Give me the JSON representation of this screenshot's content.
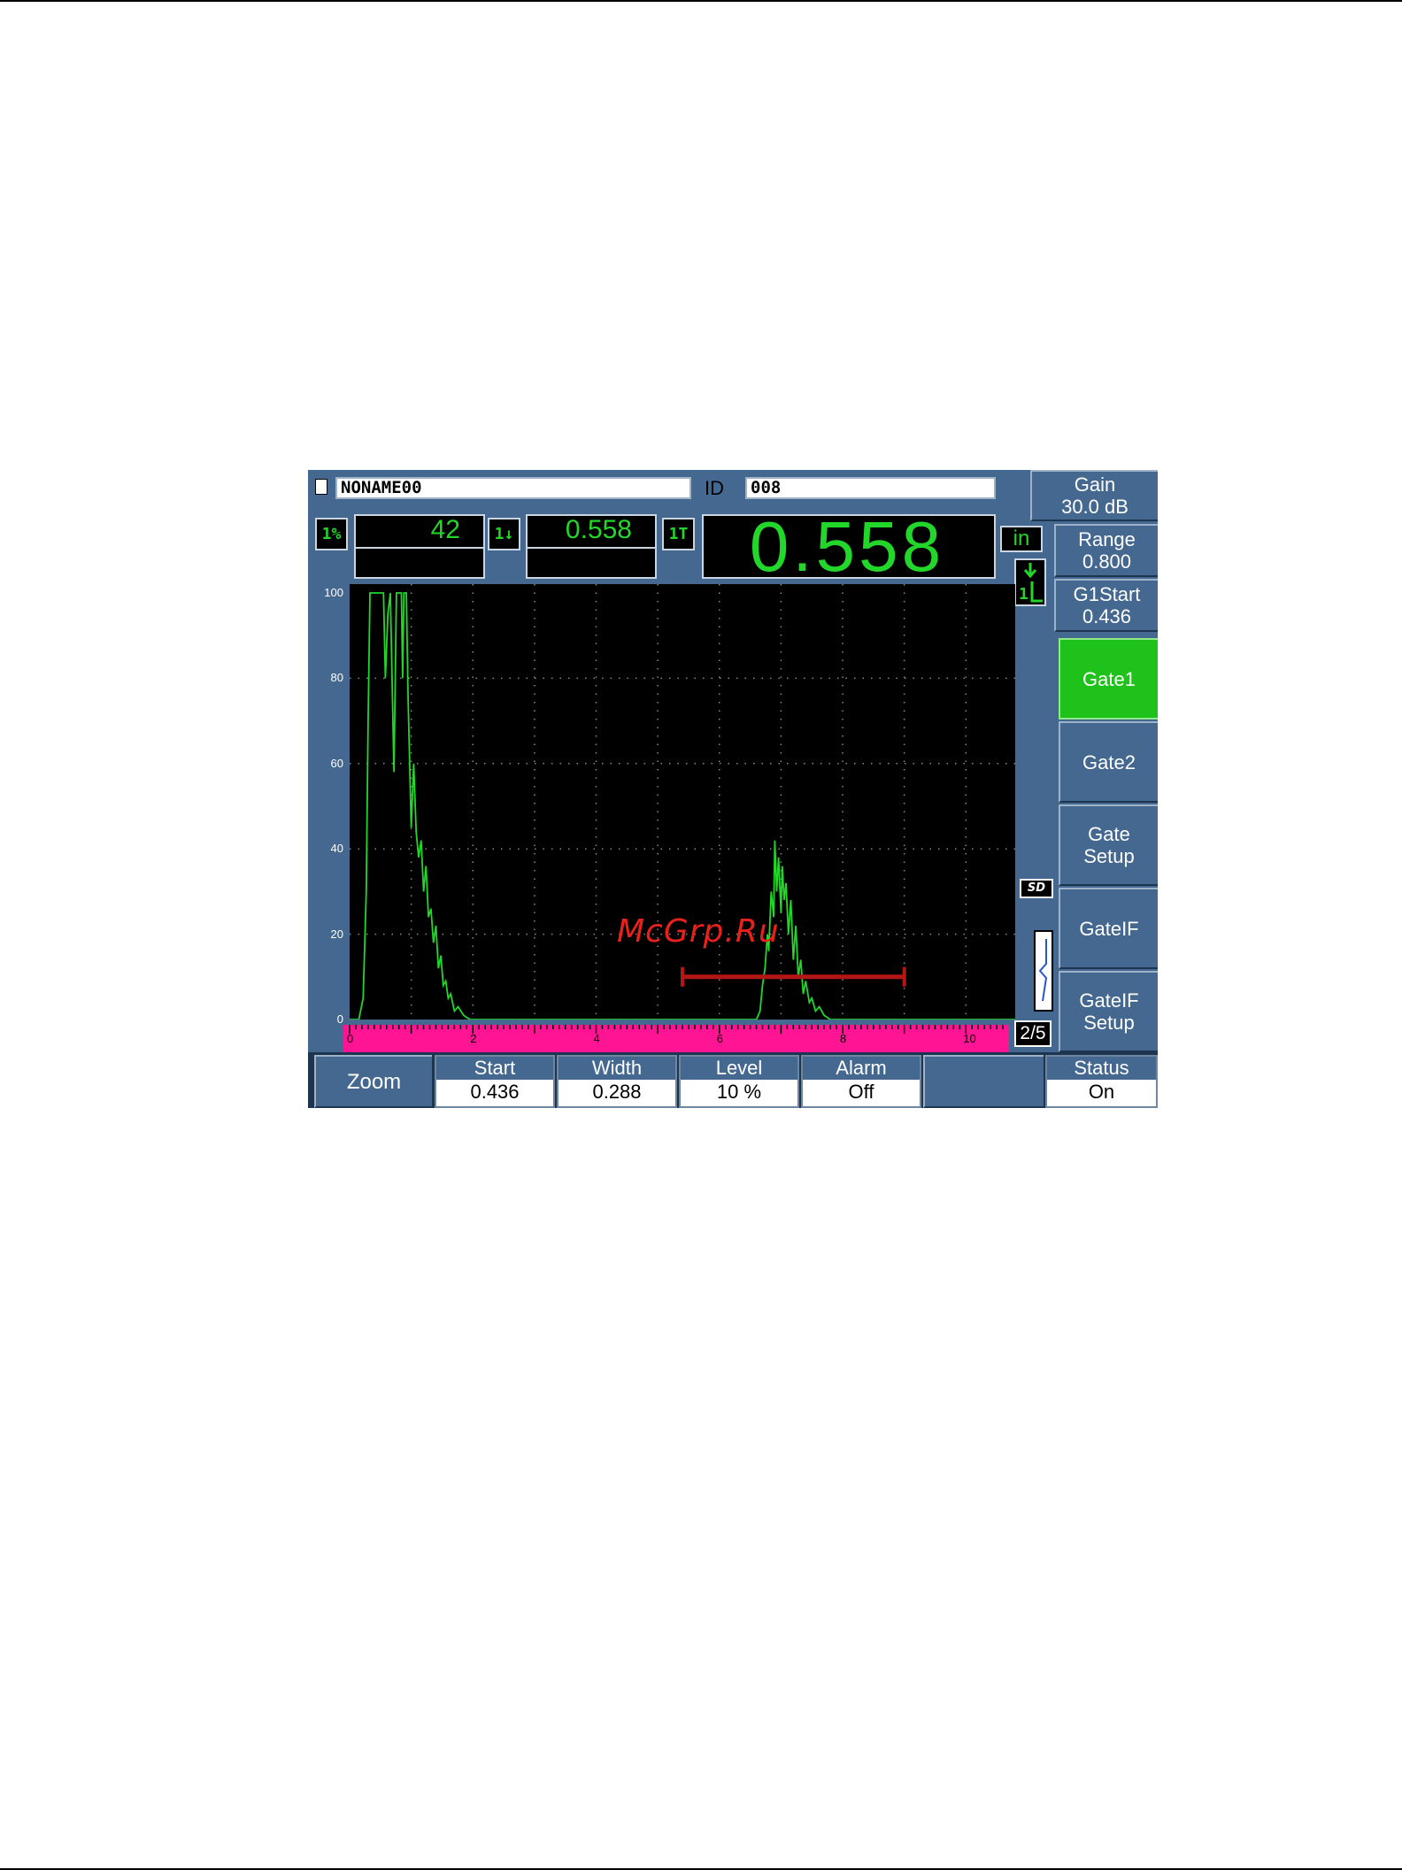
{
  "header": {
    "file_name": "NONAME00",
    "id_label": "ID",
    "id_value": "008"
  },
  "readings": {
    "r1_icon": "1%",
    "r1_value": "42",
    "r2_icon": "1↓",
    "r2_value": "0.558",
    "r3_icon": "1T",
    "big_value": "0.558",
    "units": "in"
  },
  "right_menu": {
    "gain_label": "Gain",
    "gain_value": "30.0 dB",
    "range_label": "Range",
    "range_value": "0.800",
    "g1start_label": "G1Start",
    "g1start_value": "0.436",
    "items": [
      {
        "line1": "Gate1",
        "line2": "",
        "active": true
      },
      {
        "line1": "Gate2",
        "line2": "",
        "active": false
      },
      {
        "line1": "Gate",
        "line2": "Setup",
        "active": false
      },
      {
        "line1": "GateIF",
        "line2": "",
        "active": false
      },
      {
        "line1": "GateIF",
        "line2": "Setup",
        "active": false
      }
    ],
    "page_indicator": "2/5",
    "sd_label": "SD"
  },
  "bottom_params": {
    "zoom_label": "Zoom",
    "start_label": "Start",
    "start_value": "0.436",
    "width_label": "Width",
    "width_value": "0.288",
    "level_label": "Level",
    "level_value": "10 %",
    "alarm_label": "Alarm",
    "alarm_value": "Off",
    "status_label": "Status",
    "status_value": "On"
  },
  "waveform": {
    "y_ticks": [
      "100",
      "80",
      "60",
      "40",
      "20",
      "0"
    ],
    "x_ticks": [
      "0",
      "2",
      "4",
      "6",
      "8",
      "10"
    ],
    "x_range": [
      0,
      10.8
    ],
    "y_range": [
      0,
      100
    ],
    "gate": {
      "x_start": 5.4,
      "x_end": 9.0,
      "level": 10,
      "color": "#b41616"
    },
    "trace_color": "#22d62a",
    "baseline_color": "#ff1493",
    "signal": [
      [
        0.0,
        0
      ],
      [
        0.15,
        0
      ],
      [
        0.22,
        5
      ],
      [
        0.27,
        30
      ],
      [
        0.3,
        70
      ],
      [
        0.33,
        100
      ],
      [
        0.55,
        100
      ],
      [
        0.58,
        80
      ],
      [
        0.62,
        95
      ],
      [
        0.66,
        100
      ],
      [
        0.72,
        58
      ],
      [
        0.76,
        100
      ],
      [
        0.84,
        100
      ],
      [
        0.86,
        80
      ],
      [
        0.88,
        100
      ],
      [
        0.92,
        100
      ],
      [
        0.95,
        75
      ],
      [
        1.0,
        45
      ],
      [
        1.04,
        60
      ],
      [
        1.08,
        44
      ],
      [
        1.12,
        38
      ],
      [
        1.16,
        42
      ],
      [
        1.2,
        30
      ],
      [
        1.24,
        36
      ],
      [
        1.28,
        24
      ],
      [
        1.32,
        26
      ],
      [
        1.36,
        18
      ],
      [
        1.4,
        22
      ],
      [
        1.44,
        12
      ],
      [
        1.48,
        15
      ],
      [
        1.52,
        8
      ],
      [
        1.56,
        9
      ],
      [
        1.6,
        5
      ],
      [
        1.64,
        6
      ],
      [
        1.7,
        2
      ],
      [
        1.76,
        3
      ],
      [
        1.85,
        1
      ],
      [
        1.95,
        0
      ],
      [
        6.6,
        0
      ],
      [
        6.66,
        2
      ],
      [
        6.7,
        8
      ],
      [
        6.74,
        12
      ],
      [
        6.78,
        20
      ],
      [
        6.8,
        16
      ],
      [
        6.84,
        30
      ],
      [
        6.88,
        24
      ],
      [
        6.9,
        42
      ],
      [
        6.93,
        30
      ],
      [
        6.96,
        38
      ],
      [
        7.0,
        25
      ],
      [
        7.02,
        36
      ],
      [
        7.05,
        28
      ],
      [
        7.08,
        32
      ],
      [
        7.12,
        20
      ],
      [
        7.16,
        28
      ],
      [
        7.2,
        14
      ],
      [
        7.24,
        22
      ],
      [
        7.28,
        10
      ],
      [
        7.32,
        14
      ],
      [
        7.36,
        6
      ],
      [
        7.4,
        9
      ],
      [
        7.46,
        4
      ],
      [
        7.5,
        5
      ],
      [
        7.56,
        2
      ],
      [
        7.62,
        3
      ],
      [
        7.7,
        1
      ],
      [
        7.8,
        0
      ],
      [
        10.8,
        0
      ]
    ]
  },
  "watermark": "McGrp.Ru"
}
